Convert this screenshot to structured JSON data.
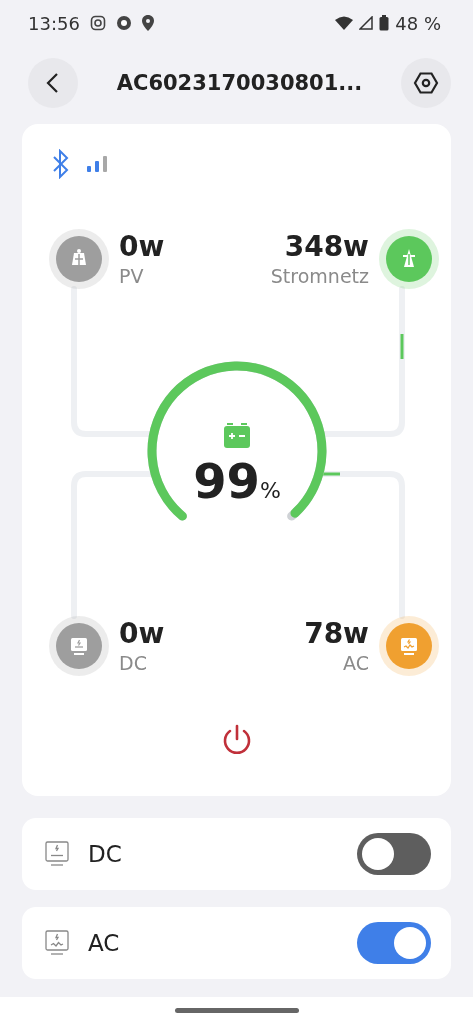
{
  "status_bar": {
    "time": "13:56",
    "battery": "48 %"
  },
  "header": {
    "title": "AC6023170030801..."
  },
  "nodes": [
    {
      "kind": "pv",
      "value": "0w",
      "label": "PV",
      "color": "#9e9e9e"
    },
    {
      "kind": "grid",
      "value": "348w",
      "label": "Stromnetz",
      "color": "#5cc85c"
    },
    {
      "kind": "dc",
      "value": "0w",
      "label": "DC",
      "color": "#9e9e9e"
    },
    {
      "kind": "ac",
      "value": "78w",
      "label": "AC",
      "color": "#f0a030"
    }
  ],
  "battery": {
    "reading": "99",
    "unit": "%"
  },
  "switches": [
    {
      "kind": "dc",
      "label": "DC",
      "on": false
    },
    {
      "kind": "ac",
      "label": "AC",
      "on": true
    }
  ]
}
